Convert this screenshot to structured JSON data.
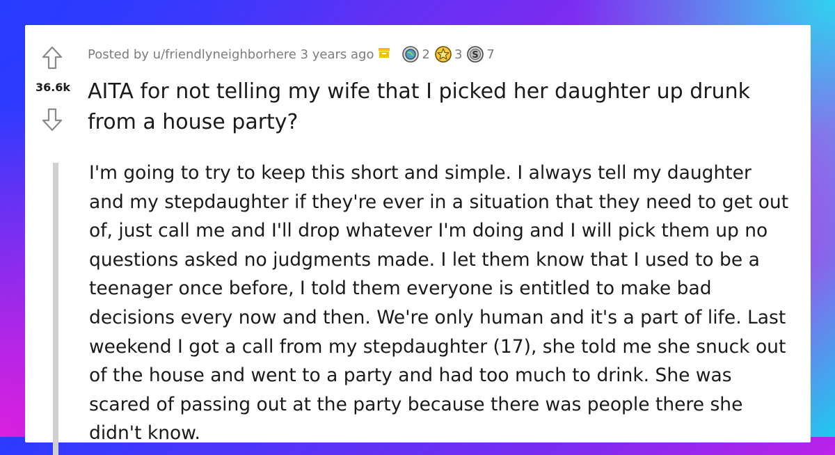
{
  "post": {
    "score": "36.6k",
    "posted_by": "Posted by u/friendlyneighborhere 3 years ago",
    "title": "AITA for not telling my wife that I picked her daughter up drunk from a house party?",
    "awards": [
      {
        "icon": "globe-award-icon",
        "count": "2"
      },
      {
        "icon": "star-award-icon",
        "count": "3"
      },
      {
        "icon": "silver-award-icon",
        "count": "7"
      }
    ],
    "body": "I'm going to try to keep this short and simple. I always tell my daughter and my stepdaughter if they're ever in a situation that they need to get out of, just call me and I'll drop whatever I'm doing and I will pick them up no questions asked no judgments made. I let them know that I used to be a teenager once before, I told them everyone is entitled to make bad decisions every now and then. We're only human and it's a part of life. Last weekend I got a call from my stepdaughter (17), she told me she snuck out of the house and went to a party and had too much to drink. She was scared of passing out at the party because there was people there she didn't know."
  },
  "colors": {
    "meta_text": "#7c7c7c",
    "title_text": "#1a1a1b",
    "archive_badge": "#f2c200",
    "quote_bar": "#d0d0d0"
  }
}
